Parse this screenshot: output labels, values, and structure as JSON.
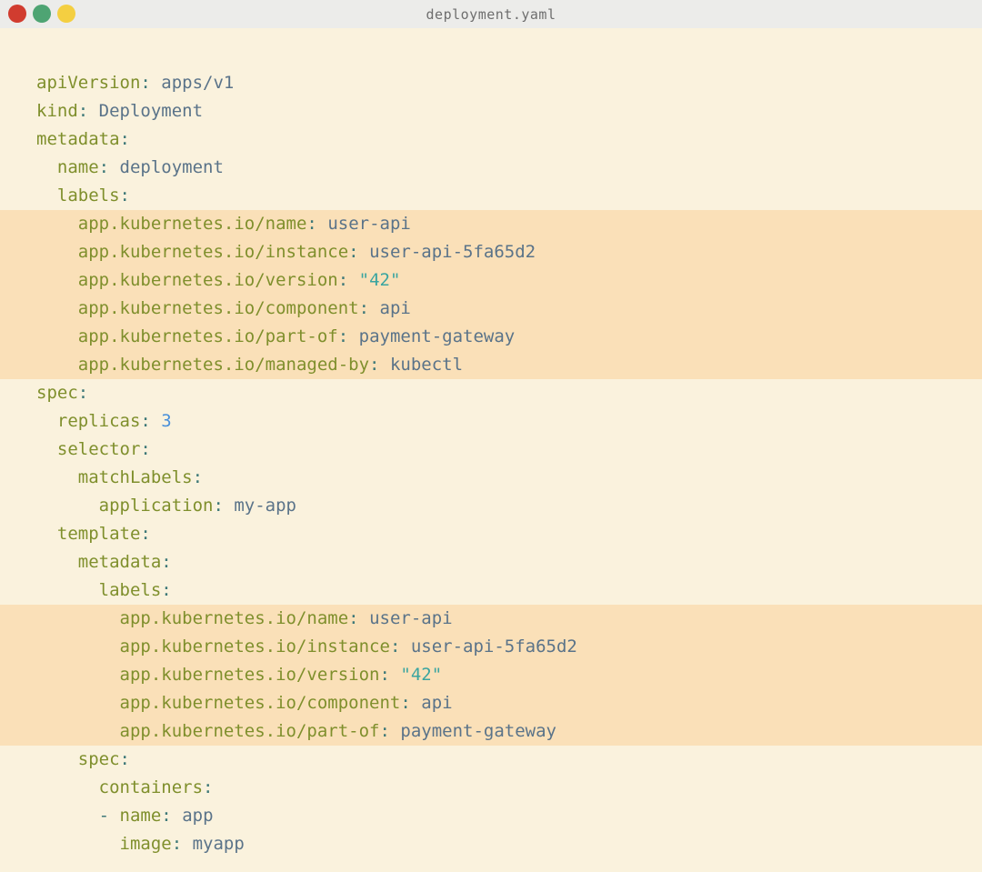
{
  "window": {
    "title": "deployment.yaml",
    "traffic_lights": [
      {
        "name": "close-button",
        "color": "#d13c2f"
      },
      {
        "name": "minimize-button",
        "color": "#4ea473"
      },
      {
        "name": "maximize-button",
        "color": "#f4cf41"
      }
    ]
  },
  "colors": {
    "titlebar-bg": "#ececea",
    "title-text": "#6e6e6e",
    "code-bg": "#faf2dd",
    "highlight-bg": "#fae0b8",
    "key": "#7f8f2c",
    "value": "#5a7389",
    "punct": "#3d7878",
    "string": "#3aa5a0",
    "number": "#4a90d9"
  },
  "code": {
    "filename": "deployment.yaml",
    "language": "yaml",
    "lines": [
      {
        "hl": false,
        "seg": [
          [
            "apiVersion",
            "k"
          ],
          [
            ": ",
            "p"
          ],
          [
            "apps/v1",
            "v"
          ]
        ]
      },
      {
        "hl": false,
        "seg": [
          [
            "kind",
            "k"
          ],
          [
            ": ",
            "p"
          ],
          [
            "Deployment",
            "v"
          ]
        ]
      },
      {
        "hl": false,
        "seg": [
          [
            "metadata",
            "k"
          ],
          [
            ":",
            "p"
          ]
        ]
      },
      {
        "hl": false,
        "seg": [
          [
            "  name",
            "k"
          ],
          [
            ": ",
            "p"
          ],
          [
            "deployment",
            "v"
          ]
        ]
      },
      {
        "hl": false,
        "seg": [
          [
            "  labels",
            "k"
          ],
          [
            ":",
            "p"
          ]
        ]
      },
      {
        "hl": true,
        "seg": [
          [
            "    app.kubernetes.io/name",
            "k"
          ],
          [
            ": ",
            "p"
          ],
          [
            "user-api",
            "v"
          ]
        ]
      },
      {
        "hl": true,
        "seg": [
          [
            "    app.kubernetes.io/instance",
            "k"
          ],
          [
            ": ",
            "p"
          ],
          [
            "user-api-5fa65d2",
            "v"
          ]
        ]
      },
      {
        "hl": true,
        "seg": [
          [
            "    app.kubernetes.io/version",
            "k"
          ],
          [
            ": ",
            "p"
          ],
          [
            "\"42\"",
            "s"
          ]
        ]
      },
      {
        "hl": true,
        "seg": [
          [
            "    app.kubernetes.io/component",
            "k"
          ],
          [
            ": ",
            "p"
          ],
          [
            "api",
            "v"
          ]
        ]
      },
      {
        "hl": true,
        "seg": [
          [
            "    app.kubernetes.io/part-of",
            "k"
          ],
          [
            ": ",
            "p"
          ],
          [
            "payment-gateway",
            "v"
          ]
        ]
      },
      {
        "hl": true,
        "seg": [
          [
            "    app.kubernetes.io/managed-by",
            "k"
          ],
          [
            ": ",
            "p"
          ],
          [
            "kubectl",
            "v"
          ]
        ]
      },
      {
        "hl": false,
        "seg": [
          [
            "spec",
            "k"
          ],
          [
            ":",
            "p"
          ]
        ]
      },
      {
        "hl": false,
        "seg": [
          [
            "  replicas",
            "k"
          ],
          [
            ": ",
            "p"
          ],
          [
            "3",
            "n"
          ]
        ]
      },
      {
        "hl": false,
        "seg": [
          [
            "  selector",
            "k"
          ],
          [
            ":",
            "p"
          ]
        ]
      },
      {
        "hl": false,
        "seg": [
          [
            "    matchLabels",
            "k"
          ],
          [
            ":",
            "p"
          ]
        ]
      },
      {
        "hl": false,
        "seg": [
          [
            "      application",
            "k"
          ],
          [
            ": ",
            "p"
          ],
          [
            "my-app",
            "v"
          ]
        ]
      },
      {
        "hl": false,
        "seg": [
          [
            "  template",
            "k"
          ],
          [
            ":",
            "p"
          ]
        ]
      },
      {
        "hl": false,
        "seg": [
          [
            "    metadata",
            "k"
          ],
          [
            ":",
            "p"
          ]
        ]
      },
      {
        "hl": false,
        "seg": [
          [
            "      labels",
            "k"
          ],
          [
            ":",
            "p"
          ]
        ]
      },
      {
        "hl": true,
        "seg": [
          [
            "        app.kubernetes.io/name",
            "k"
          ],
          [
            ": ",
            "p"
          ],
          [
            "user-api",
            "v"
          ]
        ]
      },
      {
        "hl": true,
        "seg": [
          [
            "        app.kubernetes.io/instance",
            "k"
          ],
          [
            ": ",
            "p"
          ],
          [
            "user-api-5fa65d2",
            "v"
          ]
        ]
      },
      {
        "hl": true,
        "seg": [
          [
            "        app.kubernetes.io/version",
            "k"
          ],
          [
            ": ",
            "p"
          ],
          [
            "\"42\"",
            "s"
          ]
        ]
      },
      {
        "hl": true,
        "seg": [
          [
            "        app.kubernetes.io/component",
            "k"
          ],
          [
            ": ",
            "p"
          ],
          [
            "api",
            "v"
          ]
        ]
      },
      {
        "hl": true,
        "seg": [
          [
            "        app.kubernetes.io/part-of",
            "k"
          ],
          [
            ": ",
            "p"
          ],
          [
            "payment-gateway",
            "v"
          ]
        ]
      },
      {
        "hl": false,
        "seg": [
          [
            "    spec",
            "k"
          ],
          [
            ":",
            "p"
          ]
        ]
      },
      {
        "hl": false,
        "seg": [
          [
            "      containers",
            "k"
          ],
          [
            ":",
            "p"
          ]
        ]
      },
      {
        "hl": false,
        "seg": [
          [
            "      ",
            ""
          ],
          [
            "- ",
            "p"
          ],
          [
            "name",
            "k"
          ],
          [
            ": ",
            "p"
          ],
          [
            "app",
            "v"
          ]
        ]
      },
      {
        "hl": false,
        "seg": [
          [
            "        image",
            "k"
          ],
          [
            ": ",
            "p"
          ],
          [
            "myapp",
            "v"
          ]
        ]
      }
    ]
  }
}
